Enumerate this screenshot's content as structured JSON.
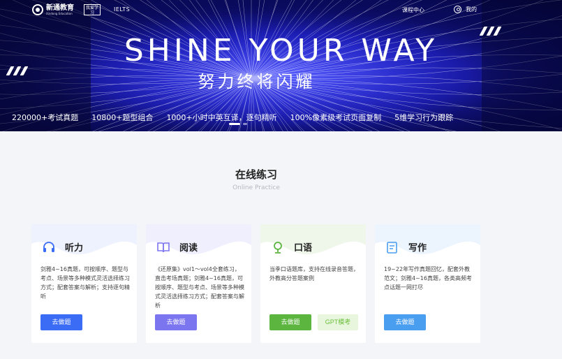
{
  "header": {
    "logo_cn": "新通教育",
    "logo_en": "Xindong Education",
    "badge_text": "我爱学习",
    "ielts": "IELTS",
    "nav": {
      "course_center": "课程中心",
      "mine": "我的"
    }
  },
  "hero": {
    "slogan_en": "SHINE YOUR WAY",
    "slogan_cn": "努力终将闪耀",
    "features": [
      "220000+考试真题",
      "10800+题型组合",
      "1000+小时中英互译，逐句精听",
      "100%像素级考试页面复制",
      "5维学习行为跟踪"
    ],
    "carousel_active": 1
  },
  "section": {
    "title": "在线练习",
    "subtitle": "Online Practice"
  },
  "cards": [
    {
      "name": "听力",
      "icon": "headphones-icon",
      "color": "#3b6cf6",
      "desc": "剑雅4~16真题，可按顺序、题型与考点、场景等多种模式灵活选择练习方式；配套答案与解析；支持逐句精听",
      "button": "去做题"
    },
    {
      "name": "阅读",
      "icon": "book-icon",
      "color": "#7c75f0",
      "desc": "《还原集》vol1～vol4全套练习，直击考场真题；剑雅4~16真题，可按顺序、题型与考点、场景等多种模式灵活选择练习方式；配套答案与解析",
      "button": "去做题"
    },
    {
      "name": "口语",
      "icon": "microphone-icon",
      "color": "#5bb53f",
      "desc": "当季口语题库，支持在线录音答题，外教高分答题案例",
      "button": "去做题",
      "button2": "GPT模考"
    },
    {
      "name": "写作",
      "icon": "pen-document-icon",
      "color": "#4a9ef0",
      "desc": "19~22年写作真题回忆，配套外教范文；剑雅4~16真题，各类高频考点话题一网打尽",
      "button": "去做题"
    }
  ]
}
